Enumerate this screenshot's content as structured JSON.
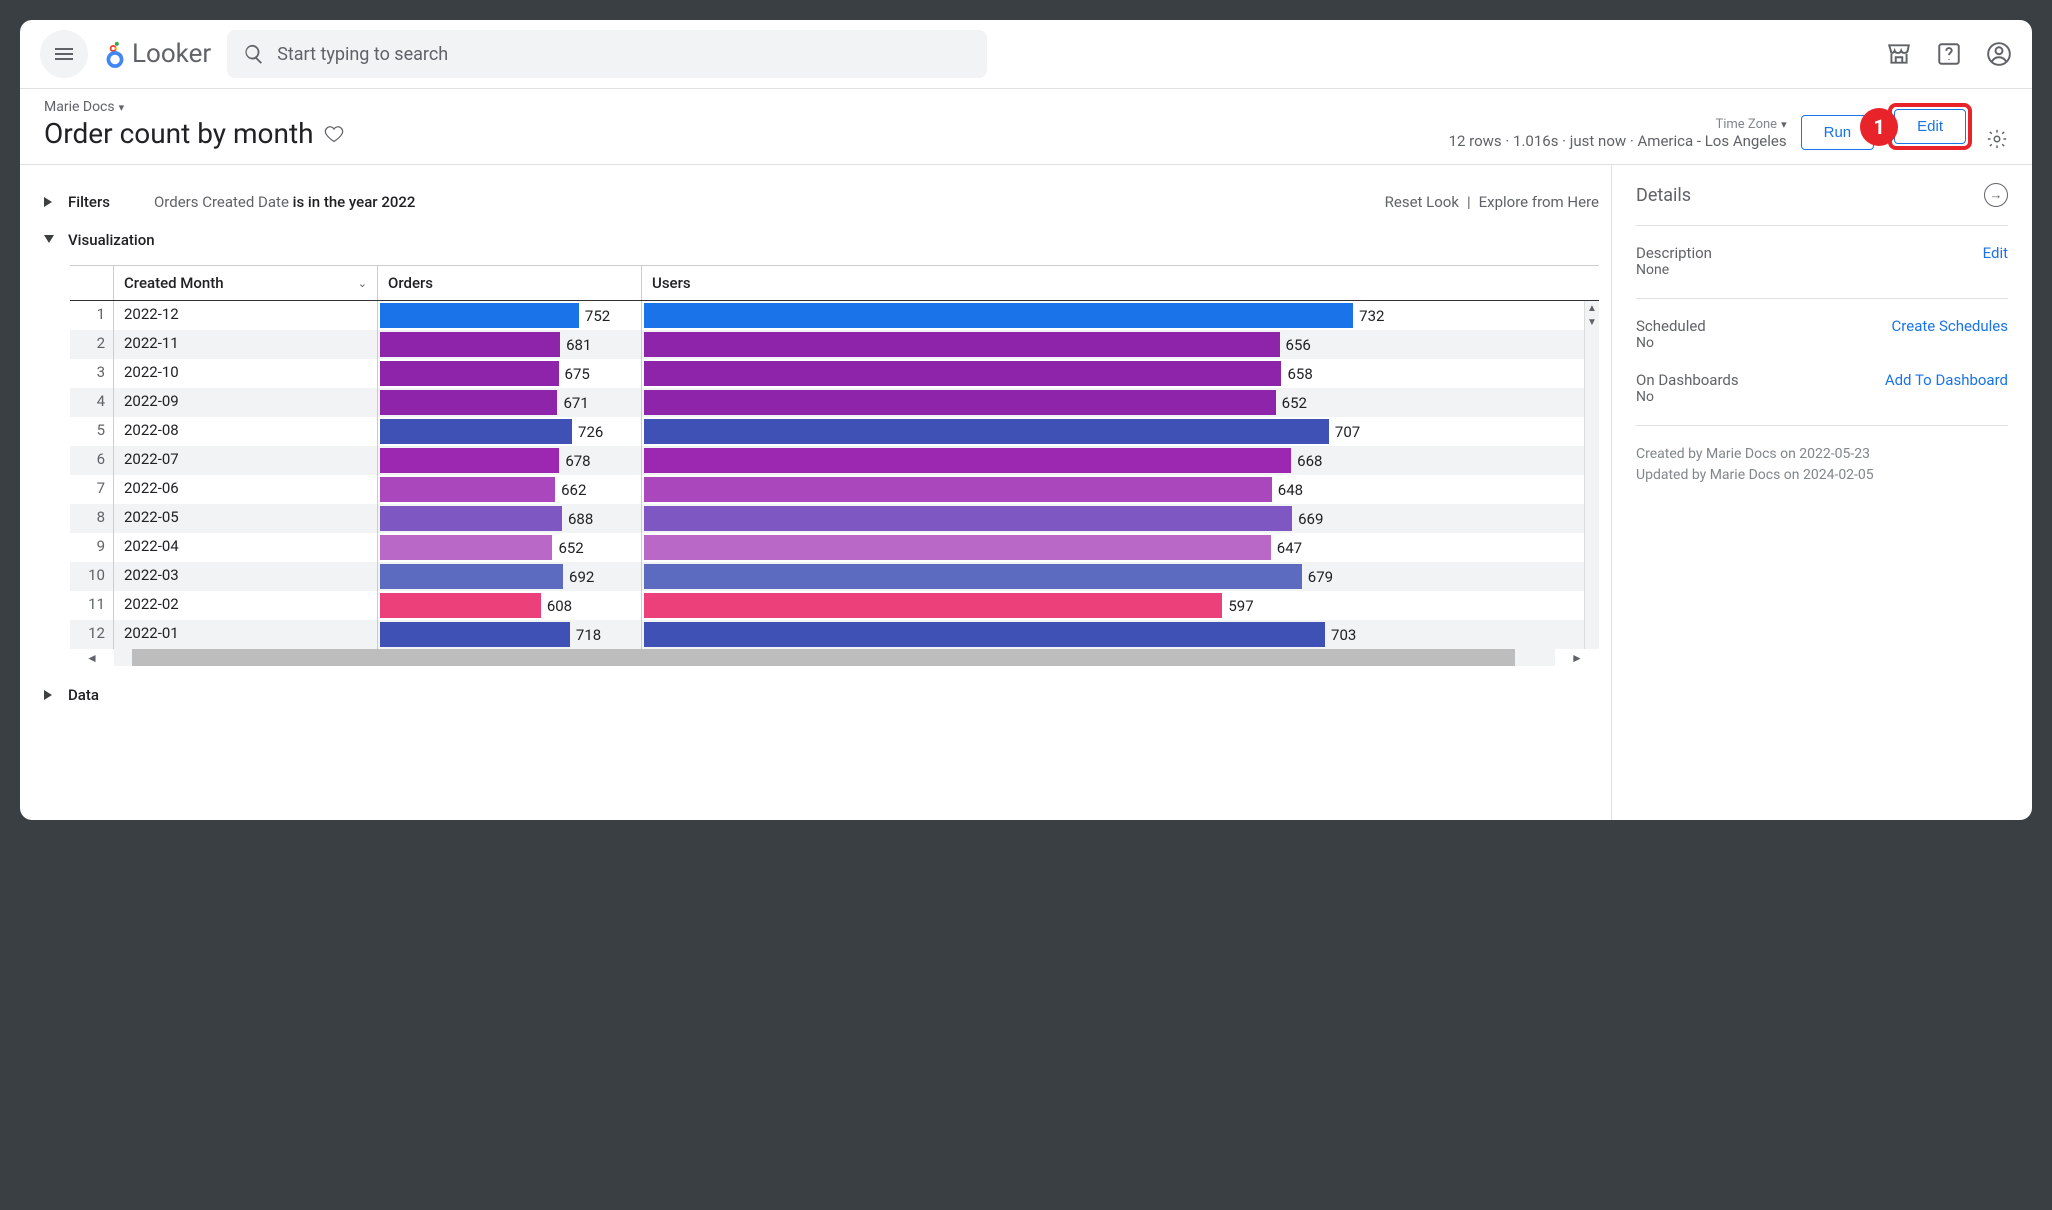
{
  "app": {
    "name": "Looker"
  },
  "search": {
    "placeholder": "Start typing to search"
  },
  "breadcrumb": "Marie Docs",
  "title": "Order count by month",
  "header": {
    "timezone_label": "Time Zone",
    "stats": "12 rows · 1.016s · just now · America - Los Angeles",
    "run_label": "Run",
    "edit_label": "Edit"
  },
  "callout": {
    "number": "1"
  },
  "sections": {
    "filters_label": "Filters",
    "filter_field": "Orders Created Date",
    "filter_value": "is in the year 2022",
    "reset_label": "Reset Look",
    "explore_label": "Explore from Here",
    "visualization_label": "Visualization",
    "data_label": "Data"
  },
  "table": {
    "columns": {
      "month": "Created Month",
      "orders": "Orders",
      "users": "Users"
    }
  },
  "chart_data": {
    "type": "bar",
    "title": "Order count by month",
    "series": [
      {
        "name": "Orders",
        "values": [
          752,
          681,
          675,
          671,
          726,
          678,
          662,
          688,
          652,
          692,
          608,
          718
        ]
      },
      {
        "name": "Users",
        "values": [
          732,
          656,
          658,
          652,
          707,
          668,
          648,
          669,
          647,
          679,
          597,
          703
        ]
      }
    ],
    "categories": [
      "2022-12",
      "2022-11",
      "2022-10",
      "2022-09",
      "2022-08",
      "2022-07",
      "2022-06",
      "2022-05",
      "2022-04",
      "2022-03",
      "2022-02",
      "2022-01"
    ],
    "colors": [
      "#1a73e8",
      "#8e24aa",
      "#8e24aa",
      "#8e24aa",
      "#3f51b5",
      "#9c27b0",
      "#ab47bc",
      "#7e57c2",
      "#ba68c8",
      "#5c6bc0",
      "#ec407a",
      "#3f51b5"
    ],
    "max": 752
  },
  "details": {
    "title": "Details",
    "description_label": "Description",
    "description_value": "None",
    "description_edit": "Edit",
    "scheduled_label": "Scheduled",
    "scheduled_value": "No",
    "scheduled_link": "Create Schedules",
    "dashboards_label": "On Dashboards",
    "dashboards_value": "No",
    "dashboards_link": "Add To Dashboard",
    "created": "Created by Marie Docs on 2022-05-23",
    "updated": "Updated by Marie Docs on 2024-02-05"
  }
}
